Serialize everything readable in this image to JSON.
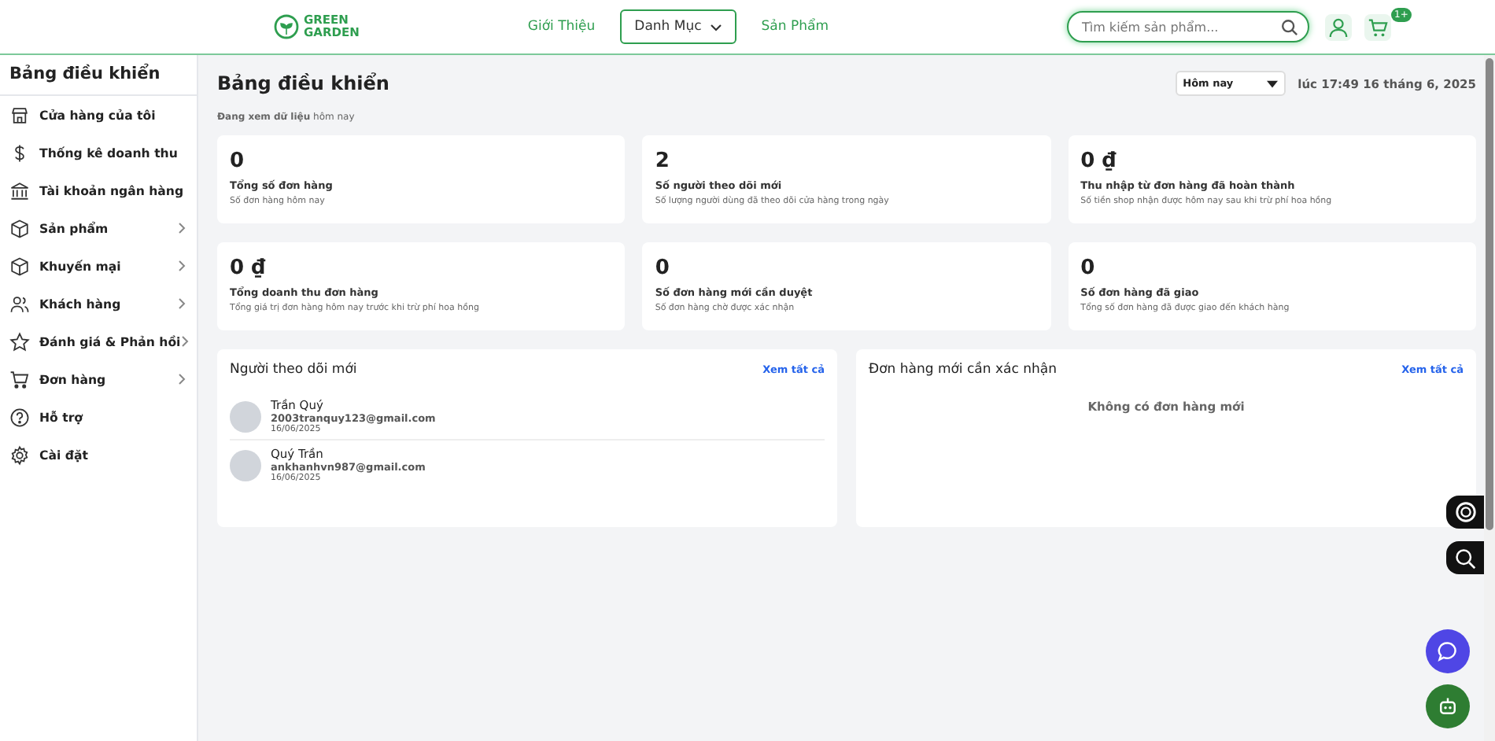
{
  "header": {
    "logo": [
      "GREEN",
      "GARDEN"
    ],
    "nav": [
      {
        "label": "Giới Thiệu",
        "selected": false,
        "dropdown": false
      },
      {
        "label": "Danh Mục",
        "selected": true,
        "dropdown": true
      },
      {
        "label": "Sản Phẩm",
        "selected": false,
        "dropdown": false
      }
    ],
    "search": {
      "placeholder": "Tìm kiếm sản phẩm..."
    },
    "cart_badge": "1+"
  },
  "sidebar": {
    "title": "Bảng điều khiển",
    "items": [
      {
        "label": "Cửa hàng của tôi",
        "kind": "store",
        "submenu": false
      },
      {
        "label": "Thống kê doanh thu",
        "kind": "dollar",
        "submenu": false
      },
      {
        "label": "Tài khoản ngân hàng",
        "kind": "bank",
        "submenu": false
      },
      {
        "label": "Sản phẩm",
        "kind": "box",
        "submenu": true
      },
      {
        "label": "Khuyến mại",
        "kind": "box",
        "submenu": true
      },
      {
        "label": "Khách hàng",
        "kind": "users",
        "submenu": true
      },
      {
        "label": "Đánh giá & Phản hồi",
        "kind": "star",
        "submenu": true
      },
      {
        "label": "Đơn hàng",
        "kind": "cart",
        "submenu": true
      },
      {
        "label": "Hỗ trợ",
        "kind": "help",
        "submenu": false
      },
      {
        "label": "Cài đặt",
        "kind": "gear",
        "submenu": false
      }
    ]
  },
  "main": {
    "title": "Bảng điều khiển",
    "period_select": "Hôm nay",
    "timestamp": "lúc 17:49 16 tháng 6, 2025",
    "viewing": "**Đang xem dữ liệu** hôm nay",
    "stats": [
      {
        "value": "0",
        "title": "Tổng số đơn hàng",
        "note": "Số đơn hàng hôm nay"
      },
      {
        "value": "2",
        "title": "Số người theo dõi mới",
        "note": "Số lượng người dùng đã theo dõi cửa hàng trong ngày"
      },
      {
        "value": "0 ₫",
        "title": "Thu nhập từ đơn hàng đã hoàn thành",
        "note": "Số tiền shop nhận được hôm nay sau khi trừ phí hoa hồng"
      },
      {
        "value": "0 ₫",
        "title": "Tổng doanh thu đơn hàng",
        "note": "Tổng giá trị đơn hàng hôm nay trước khi trừ phí hoa hồng"
      },
      {
        "value": "0",
        "title": "Số đơn hàng mới cần duyệt",
        "note": "Số đơn hàng chờ được xác nhận"
      },
      {
        "value": "0",
        "title": "Số đơn hàng đã giao",
        "note": "Tổng số đơn hàng đã được giao đến khách hàng"
      }
    ],
    "followers": {
      "title": "Người theo dõi mới",
      "link": "Xem tất cả",
      "items": [
        {
          "name": "Trần Quý",
          "email": "2003tranquy123@gmail.com",
          "date": "16/06/2025"
        },
        {
          "name": "Quý Trần",
          "email": "ankhanhvn987@gmail.com",
          "date": "16/06/2025"
        }
      ]
    },
    "orders": {
      "title": "Đơn hàng mới cần xác nhận",
      "link": "Xem tất cả",
      "empty": "Không có đơn hàng mới"
    }
  }
}
